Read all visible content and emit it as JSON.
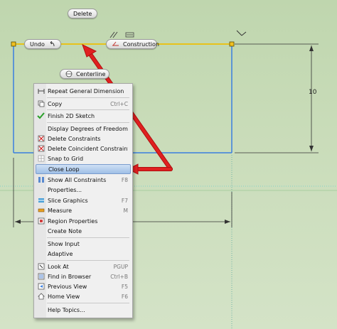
{
  "canvas_buttons": {
    "delete": "Delete",
    "undo": "Undo",
    "construction": "Construction",
    "centerline": "Centerline"
  },
  "dimension_value": "10",
  "context_menu": {
    "items": [
      {
        "label": "Repeat General Dimension",
        "shortcut": "",
        "icon": "dimension-icon"
      },
      {
        "label": "Copy",
        "shortcut": "Ctrl+C",
        "icon": "copy-icon"
      },
      {
        "label": "Finish 2D Sketch",
        "shortcut": "",
        "icon": "checkmark-icon"
      },
      {
        "label": "Display Degrees of Freedom",
        "shortcut": "",
        "icon": ""
      },
      {
        "label": "Delete Constraints",
        "shortcut": "",
        "icon": "delete-constraints-icon"
      },
      {
        "label": "Delete Coincident Constraint",
        "shortcut": "",
        "icon": "delete-coincident-icon"
      },
      {
        "label": "Snap to Grid",
        "shortcut": "",
        "icon": "snap-grid-icon"
      },
      {
        "label": "Close Loop",
        "shortcut": "",
        "icon": ""
      },
      {
        "label": "Show All Constraints",
        "shortcut": "F8",
        "icon": "constraints-icon"
      },
      {
        "label": "Properties...",
        "shortcut": "",
        "icon": ""
      },
      {
        "label": "Slice Graphics",
        "shortcut": "F7",
        "icon": "slice-graphics-icon"
      },
      {
        "label": "Measure",
        "shortcut": "M",
        "icon": "measure-icon"
      },
      {
        "label": "Region Properties",
        "shortcut": "",
        "icon": "region-properties-icon"
      },
      {
        "label": "Create Note",
        "shortcut": "",
        "icon": ""
      },
      {
        "label": "Show Input",
        "shortcut": "",
        "icon": ""
      },
      {
        "label": "Adaptive",
        "shortcut": "",
        "icon": ""
      },
      {
        "label": "Look At",
        "shortcut": "PGUP",
        "icon": "look-at-icon"
      },
      {
        "label": "Find in Browser",
        "shortcut": "Ctrl+B",
        "icon": "find-browser-icon"
      },
      {
        "label": "Previous View",
        "shortcut": "F5",
        "icon": "previous-view-icon"
      },
      {
        "label": "Home View",
        "shortcut": "F6",
        "icon": "home-view-icon"
      },
      {
        "label": "Help Topics...",
        "shortcut": "",
        "icon": ""
      }
    ],
    "highlighted": "Close Loop"
  },
  "colors": {
    "background": "#c9dcb9",
    "sketch_line_blue": "#3a7fe0",
    "sketch_line_yellow": "#e8c21a",
    "annotation_arrow": "#e02020",
    "highlight": "#9fbfe6"
  }
}
